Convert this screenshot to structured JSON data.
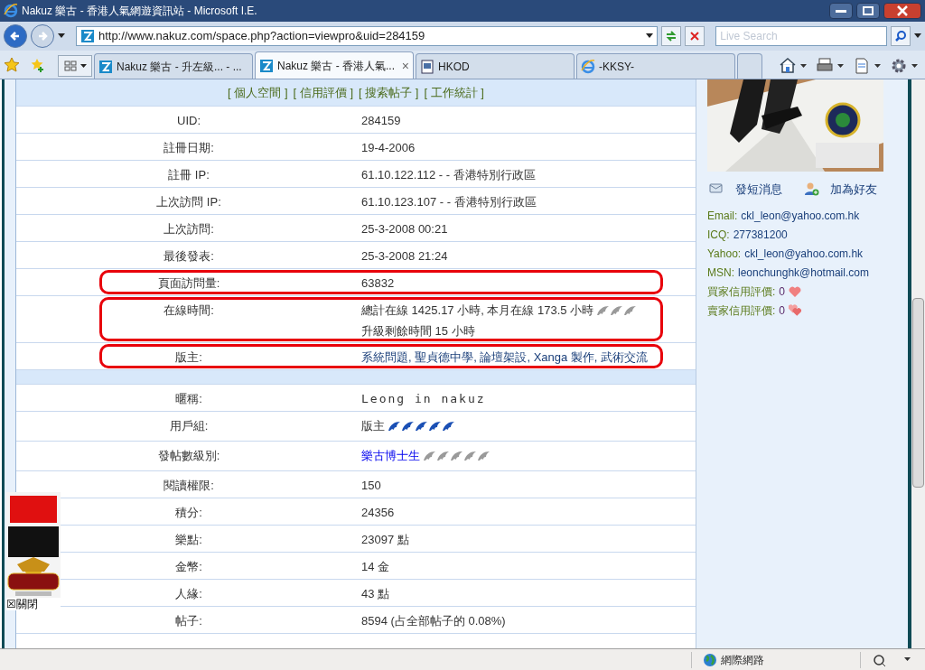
{
  "window": {
    "title": "Nakuz 樂古 - 香港人氣網遊資訊站 - Microsoft I.E."
  },
  "address_bar": {
    "url": "http://www.nakuz.com/space.php?action=viewpro&uid=284159"
  },
  "search": {
    "placeholder": "Live Search"
  },
  "tabs": [
    {
      "label": "Nakuz 樂古 - 升左級... - ...",
      "kind": "site",
      "selected": false
    },
    {
      "label": "Nakuz 樂古 - 香港人氣...",
      "kind": "site",
      "selected": true,
      "close": "×"
    },
    {
      "label": "HKOD",
      "kind": "doc",
      "selected": false
    },
    {
      "label": "-KKSY-",
      "kind": "ie",
      "selected": false
    },
    {
      "kind": "new",
      "selected": false
    }
  ],
  "profile_nav": [
    "[ 個人空間 ]",
    "[ 信用評價 ]",
    "[ 搜索帖子 ]",
    "[ 工作統計 ]"
  ],
  "profile_rows": [
    {
      "label": "UID:",
      "lines": [
        "284159"
      ],
      "highlighted": false
    },
    {
      "label": "註冊日期:",
      "lines": [
        "19-4-2006"
      ],
      "highlighted": false
    },
    {
      "label": "註冊 IP:",
      "lines": [
        "61.10.122.112 - - 香港特別行政區"
      ],
      "highlighted": false
    },
    {
      "label": "上次訪問 IP:",
      "lines": [
        "61.10.123.107 - - 香港特別行政區"
      ],
      "highlighted": false
    },
    {
      "label": "上次訪問:",
      "lines": [
        "25-3-2008 00:21"
      ],
      "highlighted": false
    },
    {
      "label": "最後發表:",
      "lines": [
        "25-3-2008 21:24"
      ],
      "highlighted": false
    },
    {
      "label": "頁面訪問量:",
      "lines": [
        "63832"
      ],
      "highlighted": true
    },
    {
      "label": "在線時間:",
      "lines": [
        "總計在線 1425.17 小時, 本月在線 173.5 小時",
        "升級剩餘時間 15 小時"
      ],
      "stars": 3,
      "color": "#9a9a9a",
      "highlighted": true
    },
    {
      "label": "版主:",
      "lines": [
        "系統問題, 聖貞德中學, 論壇架設, Xanga 製作, 武術交流"
      ],
      "kind": "link",
      "highlighted": true
    }
  ],
  "detail_rows": [
    {
      "label": "暱稱:",
      "lines": [
        "Leong in nakuz"
      ],
      "kind": "nickname"
    },
    {
      "label": "用戶組:",
      "lines": [
        "版主"
      ],
      "stars": 5,
      "color": "#1a4fb4"
    },
    {
      "label": "發帖數級別:",
      "lines": [
        "樂古博士生"
      ],
      "kind": "bright_link",
      "stars": 5,
      "color": "#9a9a9a"
    },
    {
      "label": "閱讀權限:",
      "lines": [
        "150"
      ]
    },
    {
      "label": "積分:",
      "lines": [
        "24356"
      ]
    },
    {
      "label": "樂點:",
      "lines": [
        "23097 點"
      ]
    },
    {
      "label": "金幣:",
      "lines": [
        "14 金"
      ]
    },
    {
      "label": "人緣:",
      "lines": [
        "43 點"
      ]
    },
    {
      "label": "帖子:",
      "lines": [
        "8594 (占全部帖子的 0.08%)"
      ]
    }
  ],
  "sidebar": {
    "actions": [
      {
        "label": "發短消息",
        "kind": "message"
      },
      {
        "label": "加為好友",
        "kind": "friend"
      }
    ],
    "contacts": [
      {
        "label": "Email:",
        "value": "ckl_leon@yahoo.com.hk"
      },
      {
        "label": "ICQ:",
        "value": "277381200"
      },
      {
        "label": "Yahoo:",
        "value": "ckl_leon@yahoo.com.hk"
      },
      {
        "label": "MSN:",
        "value": "leonchunghk@hotmail.com"
      }
    ],
    "ratings": [
      {
        "label": "買家信用評價:",
        "value": "0",
        "kind": "heart"
      },
      {
        "label": "賣家信用評價:",
        "value": "0",
        "kind": "hearts"
      }
    ]
  },
  "ad": {
    "close": "☒關閉"
  },
  "status_bar": {
    "zone": "網際網路"
  }
}
